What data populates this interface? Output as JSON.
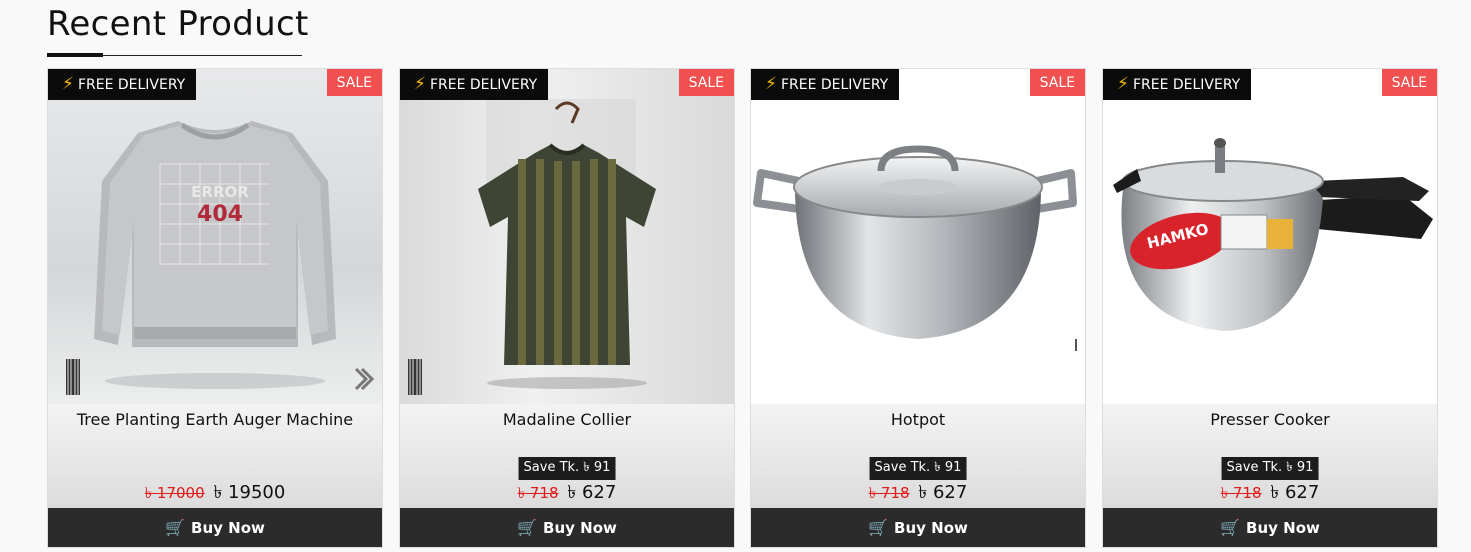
{
  "section": {
    "title": "Recent Product"
  },
  "badges": {
    "delivery": "FREE DELIVERY",
    "sale": "SALE"
  },
  "buy_label": "Buy Now",
  "currency": "৳",
  "products": [
    {
      "name": "Tree Planting Earth Auger Machine",
      "save_text": "",
      "old_price": "৳ 17000",
      "price": "৳ 19500",
      "image": "grey-sweatshirt"
    },
    {
      "name": "Madaline Collier",
      "save_text": "Save Tk. ৳ 91",
      "old_price": "৳ 718",
      "price": "৳ 627",
      "image": "olive-striped-tshirt"
    },
    {
      "name": "Hotpot",
      "save_text": "Save Tk. ৳ 91",
      "old_price": "৳ 718",
      "price": "৳ 627",
      "image": "steel-pot"
    },
    {
      "name": "Presser Cooker",
      "save_text": "Save Tk. ৳ 91",
      "old_price": "৳ 718",
      "price": "৳ 627",
      "image": "pressure-cooker"
    }
  ],
  "colors": {
    "sale": "#f0504f",
    "old_price": "#e01b1b",
    "button": "#2b2b2b",
    "bolt": "#f2b705"
  }
}
